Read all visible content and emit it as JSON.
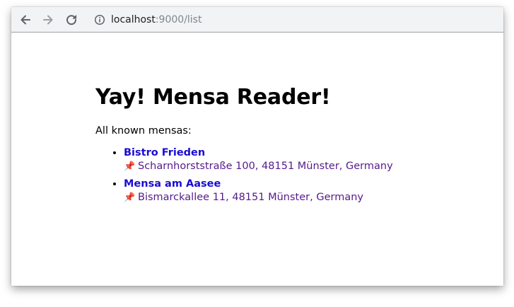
{
  "browser": {
    "url_host": "localhost",
    "url_rest": ":9000/list"
  },
  "page": {
    "title": "Yay! Mensa Reader!",
    "intro": "All known mensas:",
    "mensas": [
      {
        "name": "Bistro Frieden",
        "pin": "📌",
        "address": "Scharnhorststraße 100, 48151 Münster, Germany"
      },
      {
        "name": "Mensa am Aasee",
        "pin": "📌",
        "address": "Bismarckallee 11, 48151 Münster, Germany"
      }
    ]
  },
  "colors": {
    "link": "#1a0dd1",
    "visited": "#551a8b",
    "toolbar_bg": "#f1f3f4"
  }
}
